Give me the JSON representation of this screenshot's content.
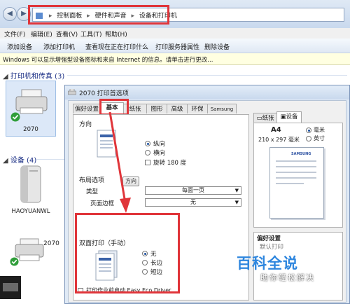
{
  "address_bar": {
    "crumbs": [
      "控制面板",
      "硬件和声音",
      "设备和打印机"
    ]
  },
  "menu": [
    "文件(F)",
    "编辑(E)",
    "查看(V)",
    "工具(T)",
    "帮助(H)"
  ],
  "toolbar": [
    "添加设备",
    "添加打印机",
    "查看现在正在打印什么",
    "打印服务器属性",
    "删除设备"
  ],
  "infobar": "Windows 可以显示增强型设备图标和来自 Internet 的信息。请单击进行更改...",
  "sections": {
    "printers": "打印机和传真 (3)",
    "devices": "设备 (4)"
  },
  "devices": {
    "printer_2070": "2070",
    "haoyuanwl": "HAOYUANWL",
    "printer_2070b": "2070"
  },
  "dialog": {
    "title": "2070 打印首选项",
    "tabs": [
      "偏好设置",
      "基本",
      "纸张",
      "图形",
      "高级",
      "环保",
      "Samsung"
    ],
    "orientation": {
      "title": "方向",
      "options": [
        "纵向",
        "横向"
      ],
      "selected": "纵向",
      "rotate_label": "旋转 180 度",
      "rotate_checked": false
    },
    "layout": {
      "title": "布局选项",
      "tooltip": "方向",
      "type_label": "类型",
      "type_value": "每面一页",
      "border_label": "页面边框",
      "border_value": "无"
    },
    "duplex": {
      "title": "双面打印（手动）",
      "options": [
        "无",
        "长边",
        "短边"
      ],
      "selected": "无"
    },
    "eco": {
      "label": "打印作业前启动 Easy Eco Driver",
      "checked": false
    },
    "right_tabs": [
      "纸张",
      "设备"
    ],
    "preview": {
      "paper": "A4",
      "size": "210 x 297 毫米",
      "units": [
        "毫米",
        "英寸"
      ],
      "selected_unit": "毫米",
      "brand": "SAMSUNG"
    },
    "favorites": {
      "title": "偏好设置",
      "item": "默认打印"
    }
  },
  "watermark": {
    "main": "百科全说",
    "sub": "助你轻松解决"
  }
}
